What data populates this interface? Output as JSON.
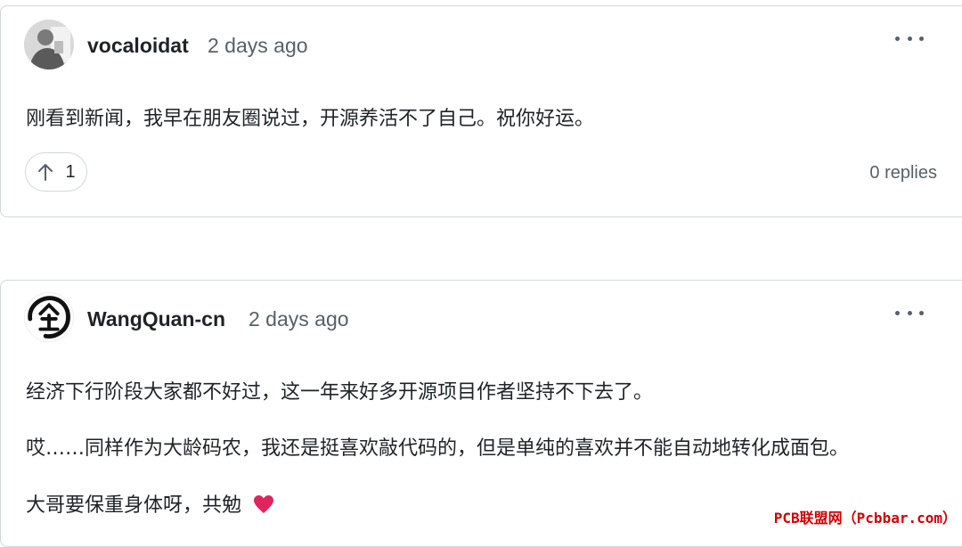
{
  "comments": [
    {
      "author": "vocaloidat",
      "time": "2 days ago",
      "avatar_icon": "user-photo-avatar",
      "body": [
        "刚看到新闻，我早在朋友圈说过，开源养活不了自己。祝你好运。"
      ],
      "upvotes": "1",
      "replies": "0 replies"
    },
    {
      "author": "WangQuan-cn",
      "time": "2 days ago",
      "avatar_icon": "calligraphy-logo-avatar",
      "body": [
        "经济下行阶段大家都不好过，这一年来好多开源项目作者坚持不下去了。",
        "哎……同样作为大龄码农，我还是挺喜欢敲代码的，但是单纯的喜欢并不能自动地转化成面包。",
        "大哥要保重身体呀，共勉"
      ],
      "emoji": "heart-emoji"
    }
  ],
  "watermark": "PCB联盟网（Pcbbar.com）",
  "colors": {
    "border": "#d0d7de",
    "muted": "#57606a",
    "text": "#1f2328",
    "heart": "#e0245e",
    "watermark": "#d40000"
  }
}
